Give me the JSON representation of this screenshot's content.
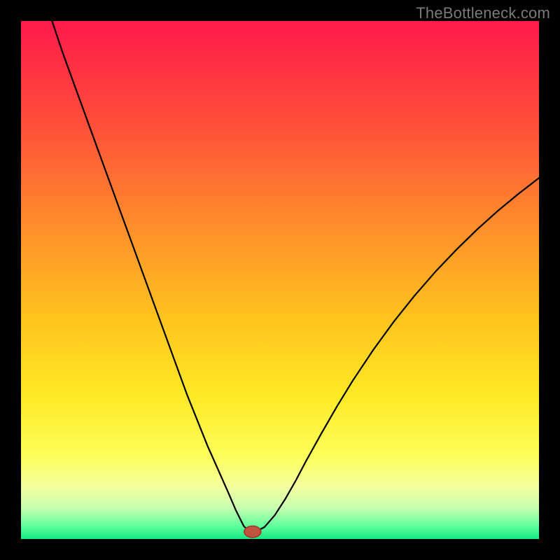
{
  "watermark": "TheBottleneck.com",
  "chart_data": {
    "type": "line",
    "title": "",
    "xlabel": "",
    "ylabel": "",
    "xlim": [
      0,
      100
    ],
    "ylim": [
      0,
      100
    ],
    "grid": false,
    "legend": false,
    "background": {
      "gradient_stops": [
        {
          "offset": 0.0,
          "color": "#ff1a4b"
        },
        {
          "offset": 0.2,
          "color": "#ff4f3a"
        },
        {
          "offset": 0.4,
          "color": "#ff8f2b"
        },
        {
          "offset": 0.58,
          "color": "#ffc51e"
        },
        {
          "offset": 0.72,
          "color": "#ffe825"
        },
        {
          "offset": 0.84,
          "color": "#fdff5a"
        },
        {
          "offset": 0.9,
          "color": "#f3ffa0"
        },
        {
          "offset": 0.94,
          "color": "#c8ffb0"
        },
        {
          "offset": 0.975,
          "color": "#5fff9d"
        },
        {
          "offset": 1.0,
          "color": "#17e884"
        }
      ]
    },
    "series": [
      {
        "name": "bottleneck-curve",
        "color": "#000000",
        "width": 2.2,
        "x": [
          6,
          8,
          10,
          12,
          14,
          16,
          18,
          20,
          22,
          24,
          26,
          28,
          30,
          32,
          34,
          36,
          38,
          40,
          41.5,
          43,
          44,
          45.5,
          47,
          49,
          51,
          53,
          55,
          58,
          61,
          64,
          68,
          72,
          76,
          80,
          84,
          88,
          92,
          96,
          100
        ],
        "y": [
          100,
          94,
          88.5,
          83,
          77.5,
          72,
          66.5,
          61,
          55.5,
          50,
          44.5,
          39,
          33.5,
          28,
          23,
          18,
          13.5,
          9,
          5.5,
          2.5,
          1.5,
          1.5,
          2.3,
          4.6,
          7.7,
          11.2,
          15,
          20.4,
          25.6,
          30.5,
          36.5,
          42,
          47,
          51.6,
          55.8,
          59.7,
          63.3,
          66.6,
          69.7
        ]
      }
    ],
    "marker": {
      "name": "optimal-point",
      "x": 44.7,
      "y": 1.4,
      "rx": 1.6,
      "ry": 1.1,
      "fill": "#c0543f",
      "stroke": "#a53a2a"
    }
  }
}
